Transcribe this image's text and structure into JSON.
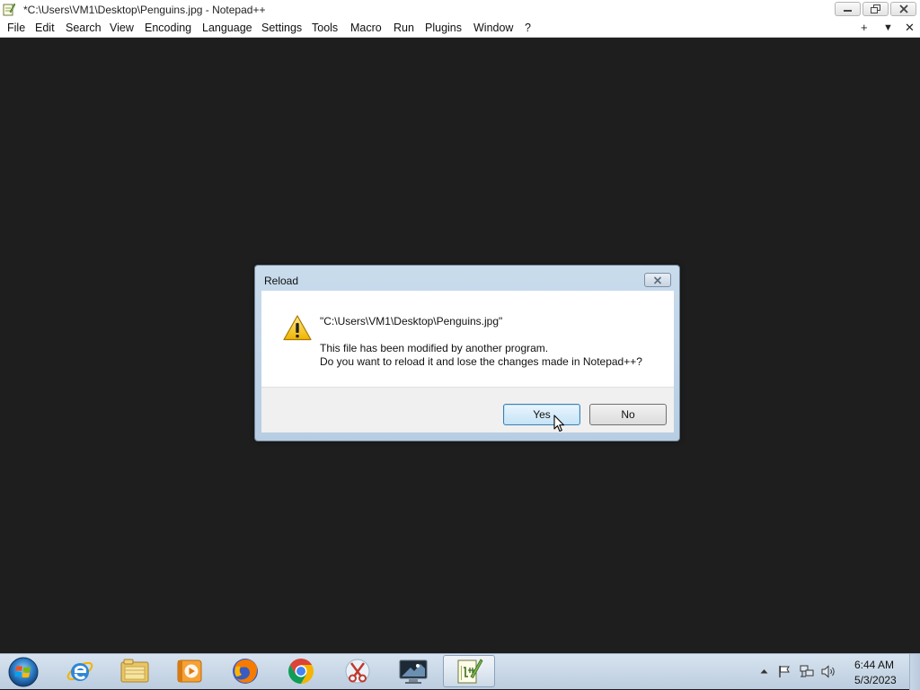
{
  "window": {
    "title": "*C:\\Users\\VM1\\Desktop\\Penguins.jpg - Notepad++",
    "app_icon": "notepadpp-icon",
    "controls": [
      "minimize-icon",
      "restore-icon",
      "close-icon"
    ]
  },
  "menubar": {
    "items": [
      "File",
      "Edit",
      "Search",
      "View",
      "Encoding",
      "Language",
      "Settings",
      "Tools",
      "Macro",
      "Run",
      "Plugins",
      "Window",
      "?"
    ],
    "right_controls": [
      "+",
      "▼",
      "✕"
    ]
  },
  "dialog": {
    "title": "Reload",
    "icon": "warning-icon",
    "path": "\"C:\\Users\\VM1\\Desktop\\Penguins.jpg\"",
    "message_line1": "This file has been modified by another program.",
    "message_line2": "Do you want to reload it and lose the changes made in Notepad++?",
    "yes_label": "Yes",
    "no_label": "No"
  },
  "taskbar": {
    "start_icon": "windows-start-icon",
    "apps": [
      "internet-explorer-icon",
      "file-explorer-icon",
      "media-player-icon",
      "firefox-icon",
      "chrome-icon",
      "snipping-tool-icon",
      "remote-desktop-icon",
      "notepadpp-icon"
    ],
    "active_app": "notepadpp-icon",
    "tray_icons": [
      "show-hidden-icons-icon",
      "action-center-flag-icon",
      "network-icon",
      "volume-icon"
    ],
    "clock_time": "6:44 AM",
    "clock_date": "5/3/2023"
  },
  "colors": {
    "editor_background": "#1e1e1e",
    "dialog_frame": "#c9dcec",
    "default_button": "#c5e3f6",
    "taskbar": "#c9d7e6"
  }
}
